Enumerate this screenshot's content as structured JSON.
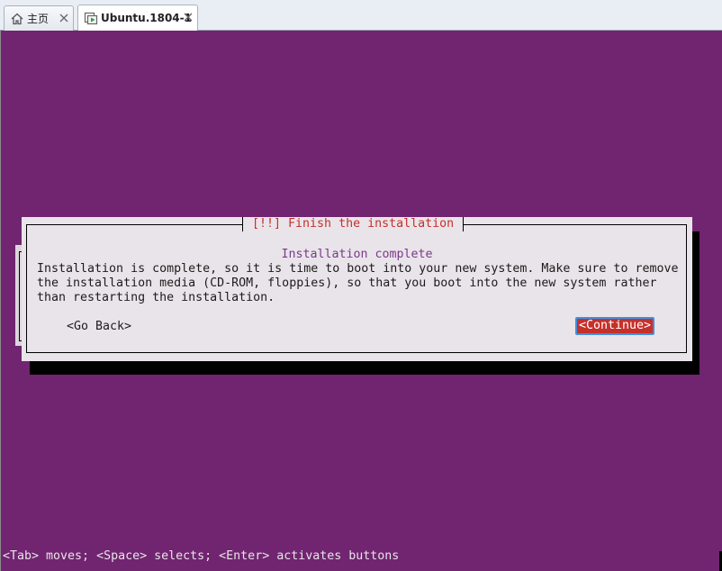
{
  "tabs": [
    {
      "label": "主页",
      "icon": "home-icon",
      "active": false
    },
    {
      "label": "Ubuntu.1804-1",
      "icon": "vm-icon",
      "active": true
    }
  ],
  "dialog": {
    "title": "[!!] Finish the installation",
    "heading": "Installation complete",
    "body": "Installation is complete, so it is time to boot into your new system. Make sure to remove\nthe installation media (CD-ROM, floppies), so that you boot into the new system rather\nthan restarting the installation.",
    "go_back_label": "<Go Back>",
    "continue_label": "<Continue>"
  },
  "statusbar": {
    "text": "<Tab> moves; <Space> selects; <Enter> activates buttons"
  },
  "colors": {
    "console_background": "#712570",
    "dialog_background": "#e9e4e9",
    "title_color": "#c6302a",
    "heading_color": "#7a3a8c",
    "continue_background": "#c6302a",
    "focus_outline": "#3f8fe0"
  }
}
